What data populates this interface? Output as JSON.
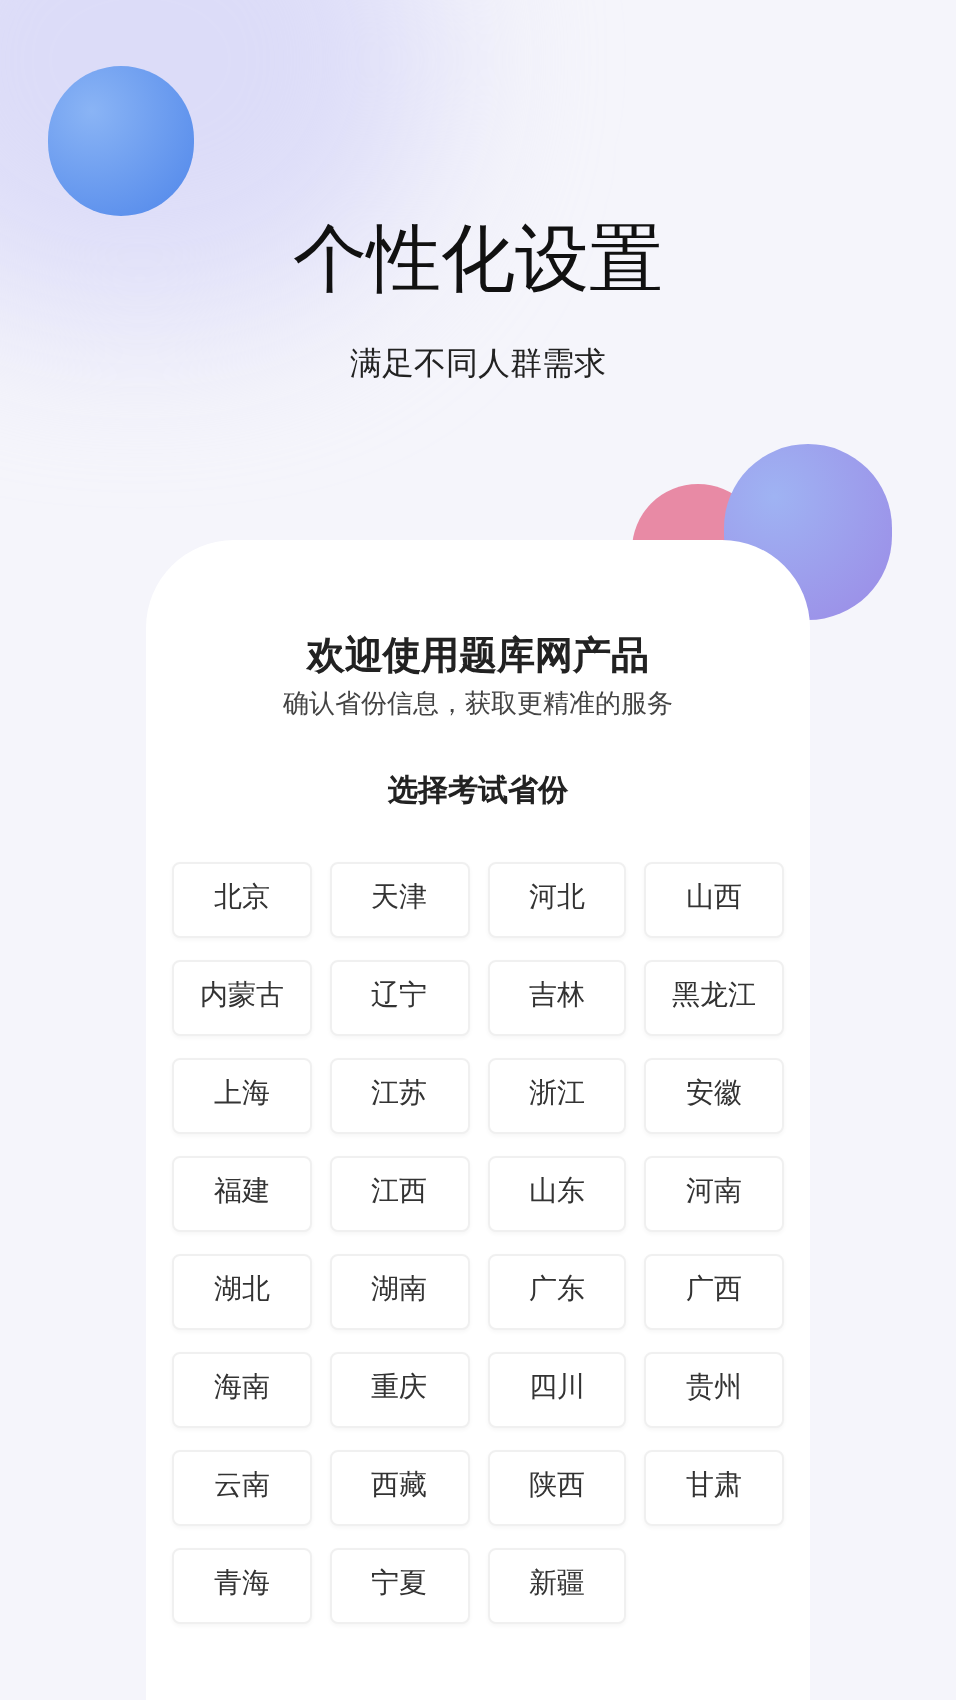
{
  "headline": "个性化设置",
  "subheadline": "满足不同人群需求",
  "card": {
    "title": "欢迎使用题库网产品",
    "subtitle": "确认省份信息，获取更精准的服务",
    "section_title": "选择考试省份",
    "provinces": [
      {
        "label": "北京",
        "selected": false
      },
      {
        "label": "天津",
        "selected": false
      },
      {
        "label": "河北",
        "selected": false
      },
      {
        "label": "山西",
        "selected": false
      },
      {
        "label": "内蒙古",
        "selected": false
      },
      {
        "label": "辽宁",
        "selected": false
      },
      {
        "label": "吉林",
        "selected": false
      },
      {
        "label": "黑龙江",
        "selected": false
      },
      {
        "label": "上海",
        "selected": false
      },
      {
        "label": "江苏",
        "selected": false
      },
      {
        "label": "浙江",
        "selected": false
      },
      {
        "label": "安徽",
        "selected": false
      },
      {
        "label": "福建",
        "selected": false
      },
      {
        "label": "江西",
        "selected": false
      },
      {
        "label": "山东",
        "selected": false
      },
      {
        "label": "河南",
        "selected": false
      },
      {
        "label": "湖北",
        "selected": false
      },
      {
        "label": "湖南",
        "selected": false
      },
      {
        "label": "广东",
        "selected": false
      },
      {
        "label": "广西",
        "selected": false
      },
      {
        "label": "海南",
        "selected": false
      },
      {
        "label": "重庆",
        "selected": false
      },
      {
        "label": "四川",
        "selected": false
      },
      {
        "label": "贵州",
        "selected": false
      },
      {
        "label": "云南",
        "selected": false
      },
      {
        "label": "西藏",
        "selected": false
      },
      {
        "label": "陕西",
        "selected": false
      },
      {
        "label": "甘肃",
        "selected": false
      },
      {
        "label": "青海",
        "selected": false
      },
      {
        "label": "宁夏",
        "selected": false
      },
      {
        "label": "新疆",
        "selected": false
      }
    ]
  }
}
